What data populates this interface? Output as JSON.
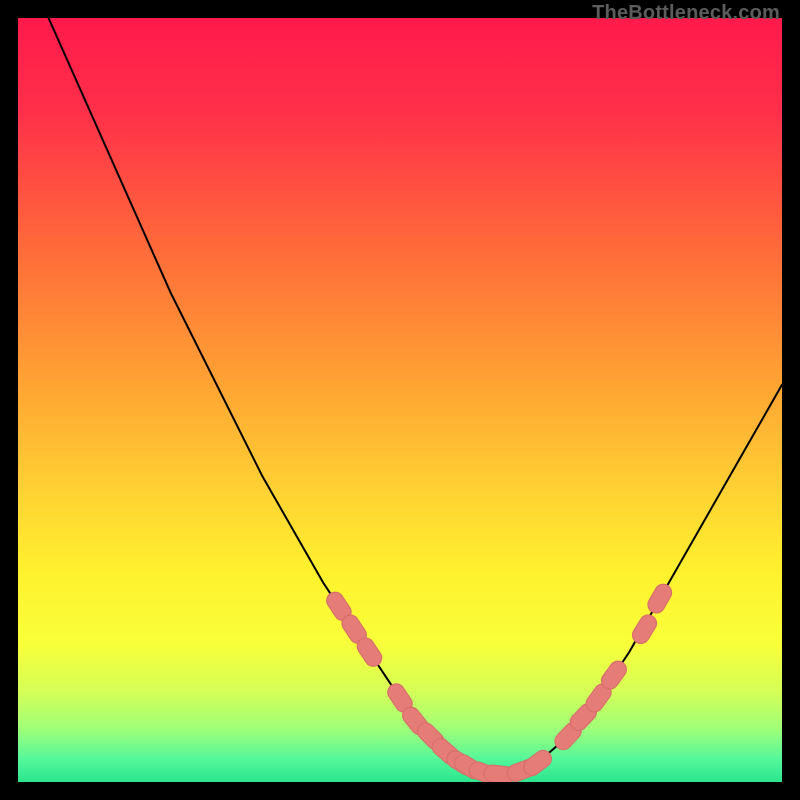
{
  "watermark": {
    "text": "TheBottleneck.com"
  },
  "colors": {
    "gradient_stops": [
      {
        "offset": 0.0,
        "color": "#ff1a4b"
      },
      {
        "offset": 0.12,
        "color": "#ff2f4a"
      },
      {
        "offset": 0.3,
        "color": "#ff6a3a"
      },
      {
        "offset": 0.48,
        "color": "#ffa433"
      },
      {
        "offset": 0.62,
        "color": "#ffd233"
      },
      {
        "offset": 0.73,
        "color": "#fff22e"
      },
      {
        "offset": 0.82,
        "color": "#f8ff3a"
      },
      {
        "offset": 0.88,
        "color": "#d6ff56"
      },
      {
        "offset": 0.93,
        "color": "#a0ff78"
      },
      {
        "offset": 0.97,
        "color": "#55f79a"
      },
      {
        "offset": 1.0,
        "color": "#2be58e"
      }
    ],
    "curve_stroke": "#000000",
    "marker_fill": "#e57c78",
    "marker_stroke": "#d86e6a"
  },
  "chart_data": {
    "type": "line",
    "title": "",
    "xlabel": "",
    "ylabel": "",
    "xlim": [
      0,
      100
    ],
    "ylim": [
      0,
      100
    ],
    "grid": false,
    "legend": false,
    "series": [
      {
        "name": "bottleneck-curve",
        "x": [
          4,
          8,
          12,
          16,
          20,
          24,
          28,
          32,
          36,
          40,
          42,
          44,
          46,
          48,
          50,
          52,
          54,
          56,
          58,
          60,
          62,
          64,
          66,
          68,
          72,
          76,
          80,
          84,
          88,
          92,
          96,
          100
        ],
        "y": [
          100,
          91,
          82,
          73,
          64,
          56,
          48,
          40,
          33,
          26,
          23,
          20,
          17,
          14,
          11,
          8,
          6,
          4,
          2.5,
          1.5,
          1,
          1,
          1.5,
          2.5,
          6,
          11,
          17,
          24,
          31,
          38,
          45,
          52
        ]
      }
    ],
    "markers": {
      "name": "highlight-segments",
      "points": [
        {
          "x": 42,
          "y": 23
        },
        {
          "x": 44,
          "y": 20
        },
        {
          "x": 46,
          "y": 17
        },
        {
          "x": 50,
          "y": 11
        },
        {
          "x": 52,
          "y": 8
        },
        {
          "x": 54,
          "y": 6
        },
        {
          "x": 56,
          "y": 4
        },
        {
          "x": 58,
          "y": 2.5
        },
        {
          "x": 59,
          "y": 2
        },
        {
          "x": 61,
          "y": 1.2
        },
        {
          "x": 63,
          "y": 1
        },
        {
          "x": 66,
          "y": 1.5
        },
        {
          "x": 68,
          "y": 2.5
        },
        {
          "x": 72,
          "y": 6
        },
        {
          "x": 74,
          "y": 8.5
        },
        {
          "x": 76,
          "y": 11
        },
        {
          "x": 78,
          "y": 14
        },
        {
          "x": 82,
          "y": 20
        },
        {
          "x": 84,
          "y": 24
        }
      ]
    }
  }
}
